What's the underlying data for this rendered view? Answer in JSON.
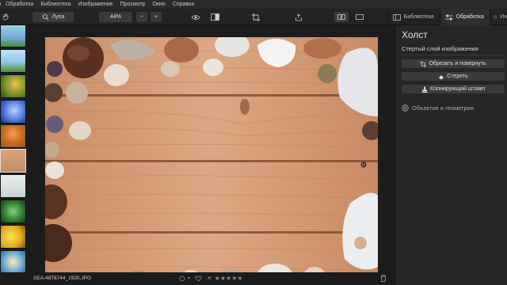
{
  "menu": [
    "л",
    "Обработка",
    "Библиотека",
    "Изображение",
    "Просмотр",
    "Окно",
    "Справка"
  ],
  "toolbar": {
    "lens_label": "Лупа",
    "zoom_value": "44%",
    "zoom_minus": "−",
    "zoom_plus": "+"
  },
  "tabs": [
    {
      "label": "Библиотека",
      "icon": "library-icon"
    },
    {
      "label": "Обработка",
      "icon": "sliders-icon"
    },
    {
      "label": "Ин",
      "icon": "info-icon"
    }
  ],
  "panel": {
    "title": "Холст",
    "subtitle": "Стертый слой изображения",
    "buttons": [
      {
        "label": "Обрезать и повернуть",
        "icon": "crop-icon"
      },
      {
        "label": "Стереть",
        "icon": "eraser-icon"
      },
      {
        "label": "Клонирующий штамп",
        "icon": "stamp-icon"
      }
    ],
    "section_label": "Объектив и геометрия"
  },
  "status": {
    "filename": "SEA-4878744_1920.JPG",
    "reject_symbol": "✕",
    "stars": "★★★★★"
  },
  "colors": {
    "accent": "#3b3b3b",
    "panel_bg": "#262626",
    "wood_light": "#d7a07a",
    "wood_dark": "#b87a55"
  }
}
